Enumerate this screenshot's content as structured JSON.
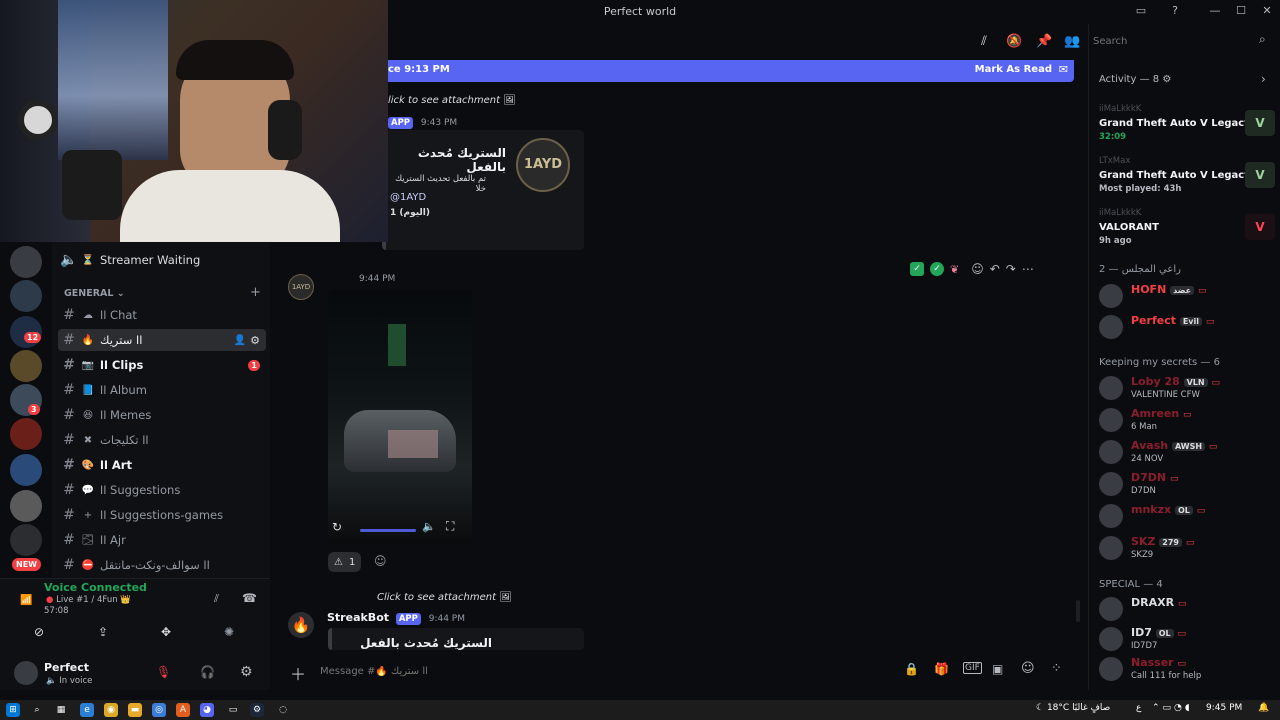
{
  "window": {
    "title": "Perfect world"
  },
  "webcam": {
    "label": ""
  },
  "rail": {
    "badges": [
      "12",
      "3",
      "NEW"
    ]
  },
  "channels": {
    "voice_channel": "Streamer Waiting",
    "voice_emoji": "⏳",
    "category": "GENERAL",
    "items": [
      {
        "emoji": "☁",
        "label": "اا Chat",
        "bold": false
      },
      {
        "emoji": "🔥",
        "label": "اا ستريك",
        "bold": false,
        "active": true
      },
      {
        "emoji": "📷",
        "label": "اا Clips",
        "bold": true,
        "badge": "1"
      },
      {
        "emoji": "📘",
        "label": "اا Album",
        "bold": false
      },
      {
        "emoji": "😆",
        "label": "اا Memes",
        "bold": false
      },
      {
        "emoji": "✖",
        "label": "اا تكليجات",
        "bold": false
      },
      {
        "emoji": "🎨",
        "label": "اا Art",
        "bold": true
      },
      {
        "emoji": "💬",
        "label": "اا Suggestions",
        "bold": false
      },
      {
        "emoji": "+",
        "label": "اا Suggestions-games",
        "bold": false
      },
      {
        "emoji": "🌫",
        "label": "اا Ajr",
        "bold": false
      },
      {
        "emoji": "⛔",
        "label": "اا سوالف-ونكت-مانتقل",
        "bold": false
      }
    ]
  },
  "voice": {
    "status": "Voice Connected",
    "channel": "Live #1 / 4Fun 👑",
    "time": "57:08"
  },
  "user": {
    "name": "Perfect",
    "status": "In voice"
  },
  "main": {
    "new_bar_time": "ce 9:13 PM",
    "mark_as_read": "Mark As Read",
    "click_attachment_1": "lick to see attachment",
    "app_tag": "APP",
    "ts_1": "9:43 PM",
    "embed_title": "الستريك مُحدث بالفعل",
    "embed_desc": "تم بالفعل تحديث الستريك خلا",
    "embed_mention": "@1AYD",
    "embed_footer": "1 (اليوم)",
    "ts_2": "9:44 PM",
    "reaction_count": "1",
    "click_attachment_2": "Click to see attachment",
    "bot_name": "StreakBot",
    "ts_3": "9:44 PM",
    "embed2_title": "الستريك مُحدث بالفعل",
    "composer_placeholder": "Message #🔥 اا ستريك"
  },
  "search": {
    "placeholder": "Search"
  },
  "right": {
    "activity_header": "Activity — 8",
    "activities": [
      {
        "user": "iiMaLkkkK",
        "game": "Grand Theft Auto V Legacy",
        "detail": "32:09",
        "detail_color": "#23a55a"
      },
      {
        "user": "LTxMax",
        "game": "Grand Theft Auto V Legacy",
        "detail": "Most played: 43h",
        "detail_color": "#b5bac1"
      },
      {
        "user": "iiMaLkkkK",
        "game": "VALORANT",
        "detail": "9h ago",
        "detail_color": "#b5bac1"
      }
    ],
    "section1": "راعي المجلس — 2",
    "section1_members": [
      {
        "name": "HOFN",
        "color": "#f23f43",
        "tag": "عضد"
      },
      {
        "name": "Perfect",
        "color": "#f23f43",
        "tag": "Evil"
      }
    ],
    "section2": "Keeping my secrets — 6",
    "section2_members": [
      {
        "name": "Loby 28",
        "color": "#8b1e2d",
        "tag": "VLN",
        "sub": "VALENTINE CFW"
      },
      {
        "name": "Amreen",
        "color": "#8b1e2d",
        "tag": "",
        "sub": "6 Man"
      },
      {
        "name": "Avash",
        "color": "#8b1e2d",
        "tag": "AWSH",
        "sub": "24 NOV"
      },
      {
        "name": "D7DN",
        "color": "#8b1e2d",
        "tag": "",
        "sub": "D7DN"
      },
      {
        "name": "mnkzx",
        "color": "#8b1e2d",
        "tag": "OL",
        "sub": ""
      },
      {
        "name": "SKZ",
        "color": "#8b1e2d",
        "tag": "279",
        "sub": "SKZ9"
      }
    ],
    "section3": "SPECIAL — 4",
    "section3_members": [
      {
        "name": "DRAXR",
        "color": "#dbdee1",
        "tag": "",
        "sub": ""
      },
      {
        "name": "ID7",
        "color": "#dbdee1",
        "tag": "OL",
        "sub": "ID7D7"
      },
      {
        "name": "Nasser",
        "color": "#8b1e2d",
        "tag": "",
        "sub": "Call 111 for help"
      }
    ]
  },
  "taskbar": {
    "weather": "18°C صافٍ غالبًا",
    "lang": "ع",
    "time": "9:45 PM"
  },
  "colors": {
    "blurple": "#5865f2",
    "red": "#f23f43",
    "green": "#23a55a"
  }
}
